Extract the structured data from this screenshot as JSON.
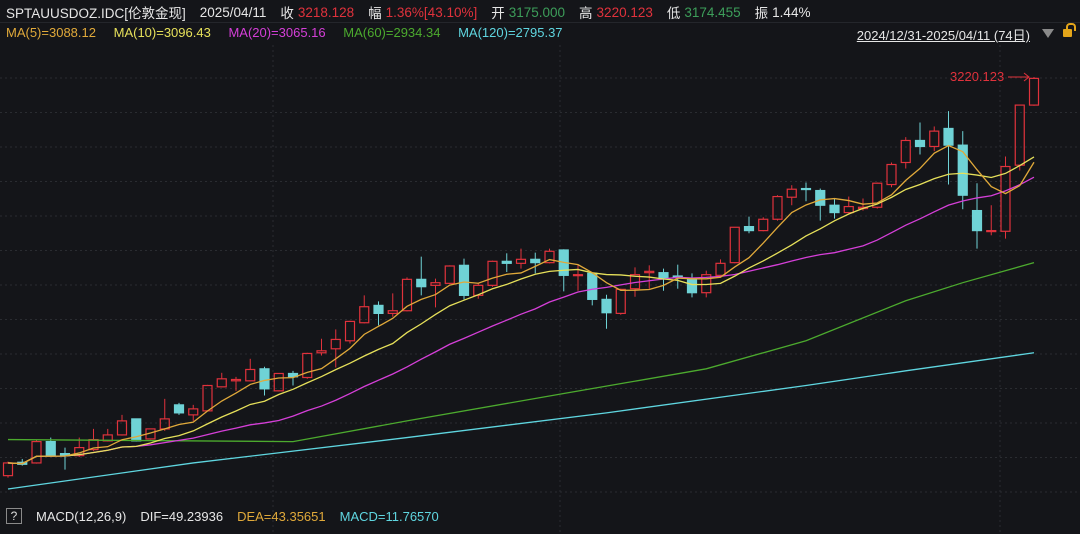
{
  "header": {
    "symbol": "SPTAUUSDOZ.IDC[伦敦金现]",
    "date": "2025/04/11",
    "close_label": "收",
    "close_value": "3218.128",
    "change_label": "幅",
    "change_value": "1.36%[43.10%]",
    "open_label": "开",
    "open_value": "3175.000",
    "high_label": "高",
    "high_value": "3220.123",
    "low_label": "低",
    "low_value": "3174.455",
    "amp_label": "振",
    "amp_value": "1.44%"
  },
  "ma_legend": {
    "ma5": "MA(5)=3088.12",
    "ma10": "MA(10)=3096.43",
    "ma20": "MA(20)=3065.16",
    "ma60": "MA(60)=2934.34",
    "ma120": "MA(120)=2795.37"
  },
  "range": {
    "label": "2024/12/31-2025/04/11 (74日)",
    "dropdown_icon": "triangle-down",
    "lock_icon": "lock-open"
  },
  "macd": {
    "help": "?",
    "title": "MACD(12,26,9)",
    "dif": "DIF=49.23936",
    "dea": "DEA=43.35651",
    "macd": "MACD=11.76570"
  },
  "colors": {
    "up": "#e0323c",
    "down": "#6fd3d6",
    "ma5": "#e0a93a",
    "ma10": "#e6e05a",
    "ma20": "#d53fd8",
    "ma60": "#4caa2e",
    "ma120": "#5fd6e0",
    "bg": "#141519"
  },
  "chart_data": {
    "type": "candlestick",
    "title": "SPTAUUSDOZ.IDC",
    "ylim": [
      2594,
      3268
    ],
    "max_label": "3220.123",
    "ohlc": [
      [
        2623,
        2644,
        2620,
        2642
      ],
      [
        2643,
        2648,
        2638,
        2640
      ],
      [
        2642,
        2677,
        2641,
        2674
      ],
      [
        2674,
        2680,
        2653,
        2653
      ],
      [
        2656,
        2665,
        2632,
        2653
      ],
      [
        2653,
        2680,
        2651,
        2665
      ],
      [
        2662,
        2693,
        2660,
        2677
      ],
      [
        2675,
        2693,
        2674,
        2684
      ],
      [
        2684,
        2714,
        2683,
        2705
      ],
      [
        2708,
        2708,
        2674,
        2675
      ],
      [
        2678,
        2693,
        2677,
        2693
      ],
      [
        2693,
        2738,
        2690,
        2708
      ],
      [
        2729,
        2732,
        2714,
        2717
      ],
      [
        2714,
        2729,
        2705,
        2723
      ],
      [
        2720,
        2759,
        2719,
        2758
      ],
      [
        2756,
        2777,
        2755,
        2768
      ],
      [
        2765,
        2771,
        2750,
        2767
      ],
      [
        2765,
        2798,
        2764,
        2782
      ],
      [
        2783,
        2786,
        2743,
        2753
      ],
      [
        2750,
        2776,
        2749,
        2776
      ],
      [
        2776,
        2780,
        2758,
        2771
      ],
      [
        2770,
        2807,
        2768,
        2806
      ],
      [
        2807,
        2828,
        2803,
        2810
      ],
      [
        2813,
        2842,
        2785,
        2827
      ],
      [
        2825,
        2855,
        2821,
        2854
      ],
      [
        2852,
        2893,
        2851,
        2876
      ],
      [
        2878,
        2884,
        2848,
        2866
      ],
      [
        2866,
        2896,
        2861,
        2870
      ],
      [
        2870,
        2920,
        2869,
        2917
      ],
      [
        2917,
        2951,
        2893,
        2906
      ],
      [
        2908,
        2918,
        2875,
        2912
      ],
      [
        2911,
        2938,
        2910,
        2937
      ],
      [
        2938,
        2948,
        2887,
        2893
      ],
      [
        2893,
        2912,
        2888,
        2908
      ],
      [
        2908,
        2945,
        2906,
        2944
      ],
      [
        2944,
        2956,
        2928,
        2941
      ],
      [
        2941,
        2963,
        2933,
        2947
      ],
      [
        2947,
        2957,
        2926,
        2942
      ],
      [
        2942,
        2963,
        2941,
        2959
      ],
      [
        2961,
        2962,
        2899,
        2923
      ],
      [
        2923,
        2939,
        2900,
        2924
      ],
      [
        2926,
        2927,
        2878,
        2887
      ],
      [
        2887,
        2894,
        2843,
        2867
      ],
      [
        2866,
        2903,
        2864,
        2902
      ],
      [
        2903,
        2935,
        2891,
        2924
      ],
      [
        2927,
        2938,
        2903,
        2929
      ],
      [
        2927,
        2933,
        2900,
        2918
      ],
      [
        2922,
        2939,
        2903,
        2921
      ],
      [
        2918,
        2926,
        2890,
        2897
      ],
      [
        2897,
        2930,
        2890,
        2924
      ],
      [
        2923,
        2947,
        2921,
        2941
      ],
      [
        2942,
        2995,
        2941,
        2995
      ],
      [
        2996,
        3011,
        2986,
        2990
      ],
      [
        2990,
        3010,
        2989,
        3007
      ],
      [
        3007,
        3043,
        3005,
        3041
      ],
      [
        3040,
        3058,
        3028,
        3052
      ],
      [
        3053,
        3062,
        3034,
        3052
      ],
      [
        3050,
        3053,
        3005,
        3028
      ],
      [
        3028,
        3038,
        3008,
        3017
      ],
      [
        3017,
        3041,
        3016,
        3026
      ],
      [
        3023,
        3038,
        3020,
        3025
      ],
      [
        3025,
        3062,
        3023,
        3061
      ],
      [
        3059,
        3092,
        3055,
        3089
      ],
      [
        3092,
        3130,
        3083,
        3125
      ],
      [
        3125,
        3152,
        3104,
        3116
      ],
      [
        3116,
        3146,
        3109,
        3139
      ],
      [
        3143,
        3169,
        3059,
        3118
      ],
      [
        3118,
        3139,
        3022,
        3043
      ],
      [
        3020,
        3061,
        2963,
        2990
      ],
      [
        2989,
        3028,
        2983,
        2990
      ],
      [
        2989,
        3101,
        2978,
        3086
      ],
      [
        3088,
        3178,
        3080,
        3178
      ],
      [
        3178,
        3220,
        3177,
        3218
      ]
    ],
    "ma60": [
      [
        0,
        2677
      ],
      [
        20,
        2674
      ],
      [
        28,
        2705
      ],
      [
        39,
        2746
      ],
      [
        49,
        2783
      ],
      [
        56,
        2825
      ],
      [
        63,
        2885
      ],
      [
        67,
        2912
      ],
      [
        72,
        2942
      ]
    ],
    "ma120": [
      [
        0,
        2603
      ],
      [
        13,
        2642
      ],
      [
        28,
        2680
      ],
      [
        42,
        2717
      ],
      [
        56,
        2758
      ],
      [
        63,
        2780
      ],
      [
        72,
        2807
      ]
    ]
  }
}
